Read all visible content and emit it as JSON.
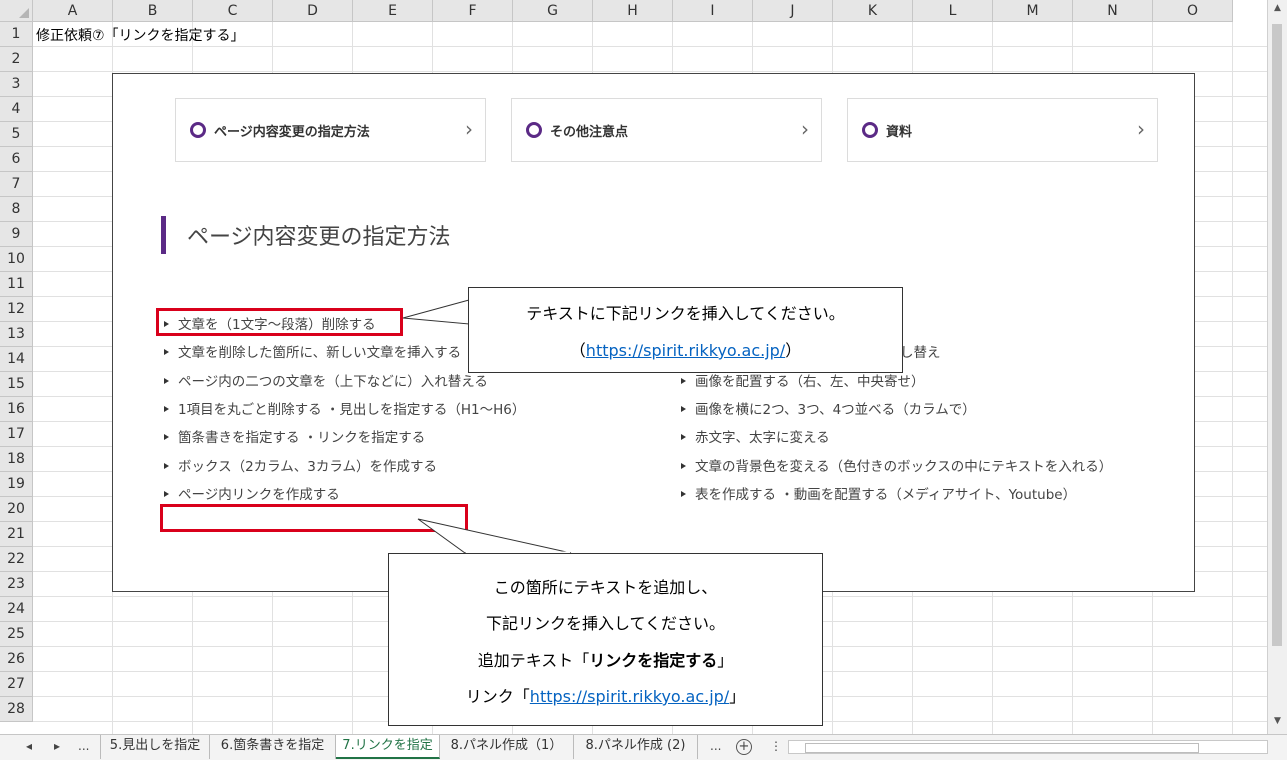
{
  "spreadsheet": {
    "columns": [
      "A",
      "B",
      "C",
      "D",
      "E",
      "F",
      "G",
      "H",
      "I",
      "J",
      "K",
      "L",
      "M",
      "N",
      "O"
    ],
    "rows": [
      "1",
      "2",
      "3",
      "4",
      "5",
      "6",
      "7",
      "8",
      "9",
      "10",
      "11",
      "12",
      "13",
      "14",
      "15",
      "16",
      "17",
      "18",
      "19",
      "20",
      "21",
      "22",
      "23",
      "24",
      "25",
      "26",
      "27",
      "28"
    ],
    "cell_a1": "修正依頼⑦「リンクを指定する」"
  },
  "screenshot": {
    "nav_buttons": [
      {
        "label": "ページ内容変更の指定方法",
        "chevron": "›"
      },
      {
        "label": "その他注意点",
        "chevron": "›"
      },
      {
        "label": "資料",
        "chevron": "›"
      }
    ],
    "section_title": "ページ内容変更の指定方法",
    "left_items": [
      "文章を（1文字～段落）削除する",
      "文章を削除した箇所に、新しい文章を挿入する",
      "ページ内の二つの文章を（上下などに）入れ替える",
      "1項目を丸ごと削除する ・見出しを指定する（H1～H6）",
      "箇条書きを指定する ・リンクを指定する",
      "ボックス（2カラム、3カラム）を作成する",
      "ページ内リンクを作成する"
    ],
    "right_items": [
      "し替え",
      "画像を配置する（右、左、中央寄せ）",
      "画像を横に2つ、3つ、4つ並べる（カラムで）",
      "赤文字、太字に変える",
      "文章の背景色を変える（色付きのボックスの中にテキストを入れる）",
      "表を作成する ・動画を配置する（メディアサイト、Youtube）"
    ]
  },
  "callout1": {
    "line1": "テキストに下記リンクを挿入してください。",
    "open": "（",
    "link": "https://spirit.rikkyo.ac.jp/",
    "close": "）"
  },
  "callout2": {
    "line1": "この箇所にテキストを追加し、",
    "line2": "下記リンクを挿入してください。",
    "line3_prefix": "追加テキスト「",
    "line3_bold": "リンクを指定する",
    "line3_suffix": "」",
    "line4_prefix": "リンク「",
    "line4_link": "https://spirit.rikkyo.ac.jp/",
    "line4_suffix": "」"
  },
  "tabs": {
    "nav_prev": "◂",
    "nav_next": "▸",
    "ellipsis_left": "...",
    "items": [
      "5.見出しを指定",
      "6.箇条書きを指定",
      "7.リンクを指定",
      "8.パネル作成（1）",
      "8.パネル作成 (2)"
    ],
    "active_index": 2,
    "ellipsis_right": "...",
    "add": "+",
    "options": "⋮"
  }
}
